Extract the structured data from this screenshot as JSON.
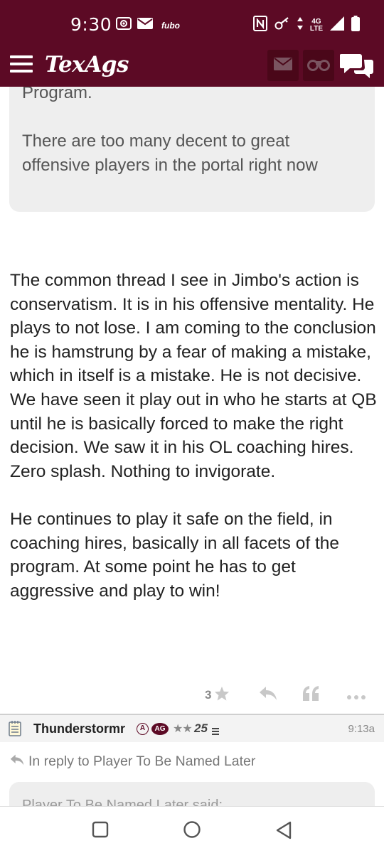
{
  "status_bar": {
    "time": "9:30",
    "notification_app": "fubo",
    "network": "4G",
    "network_sub": "LTE"
  },
  "header": {
    "brand": "TexAgs",
    "icons": [
      "menu-icon",
      "mail-icon",
      "binoculars-icon",
      "chat-icon"
    ]
  },
  "quote": {
    "line1": "Program.",
    "line2": "There are too many decent to great offensive players in the portal right now"
  },
  "post": {
    "paragraphs": [
      "The common thread I see in Jimbo's action is conservatism. It is in his offensive mentality. He plays to not lose. I am coming to the conclusion he is hamstrung by a fear of making a mistake, which in itself is a mistake. He is not decisive. We have seen it play out in who he starts at QB until he is basically forced to make the right decision. We saw it in his OL coaching hires. Zero splash. Nothing to invigorate.",
      "He continues to play it safe on the field, in coaching hires, basically in all facets of the program. At some point he has to get aggressive and play to win!"
    ],
    "star_count": "3",
    "actions": [
      "star-icon",
      "reply-icon",
      "quote-icon",
      "more-icon"
    ]
  },
  "reply": {
    "username": "Thunderstormr",
    "badge_a": "A",
    "badge_ag": "AG",
    "rank_stars": "★★",
    "post_count": "25",
    "time": "9:13a",
    "in_reply_to": "In reply to Player To Be Named Later",
    "next_quote": "Player To Be Named Later said:"
  },
  "colors": {
    "maroon": "#5c0a25",
    "dark_maroon": "#4a0719",
    "quote_bg": "#eeeeee",
    "muted": "#888888"
  }
}
